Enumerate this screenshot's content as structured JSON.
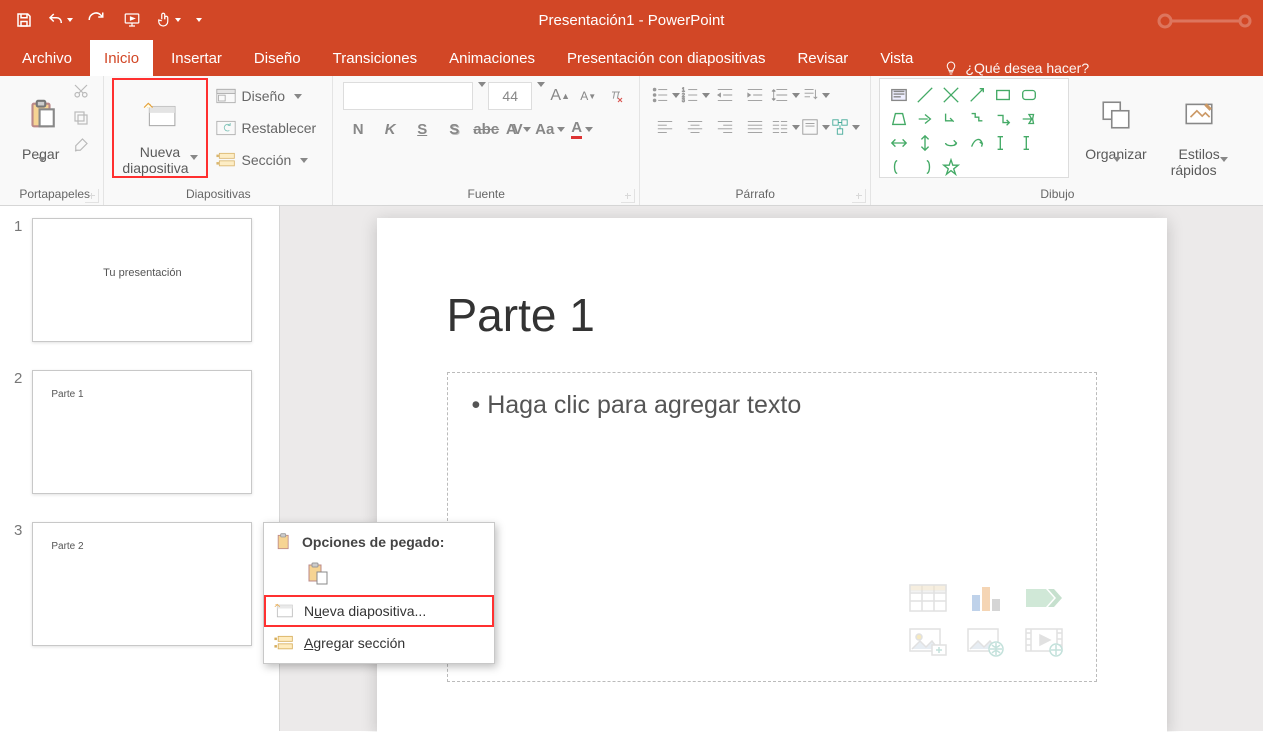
{
  "app_title": "Presentación1 - PowerPoint",
  "tabs": [
    "Archivo",
    "Inicio",
    "Insertar",
    "Diseño",
    "Transiciones",
    "Animaciones",
    "Presentación con diapositivas",
    "Revisar",
    "Vista"
  ],
  "active_tab_index": 1,
  "tell_me": "¿Qué desea hacer?",
  "groups": {
    "portapapeles": {
      "label": "Portapapeles",
      "pegar": "Pegar"
    },
    "diapositivas": {
      "label": "Diapositivas",
      "nueva": "Nueva\ndiapositiva",
      "diseno": "Diseño",
      "restablecer": "Restablecer",
      "seccion": "Sección"
    },
    "fuente": {
      "label": "Fuente",
      "font_size": "44"
    },
    "parrafo": {
      "label": "Párrafo"
    },
    "dibujo": {
      "label": "Dibujo",
      "organizar": "Organizar",
      "estilos": "Estilos\nrápidos"
    }
  },
  "slides": [
    {
      "num": "1",
      "title": "Tu presentación"
    },
    {
      "num": "2",
      "title": "Parte 1"
    },
    {
      "num": "3",
      "title": "Parte 2"
    }
  ],
  "editor": {
    "title": "Parte 1",
    "placeholder": "• Haga clic para agregar texto"
  },
  "ctx": {
    "paste_opts": "Opciones de pegado:",
    "nueva": "Nueva diapositiva...",
    "nueva_ul": "u",
    "seccion": "Agregar sección",
    "seccion_ul": "A"
  }
}
